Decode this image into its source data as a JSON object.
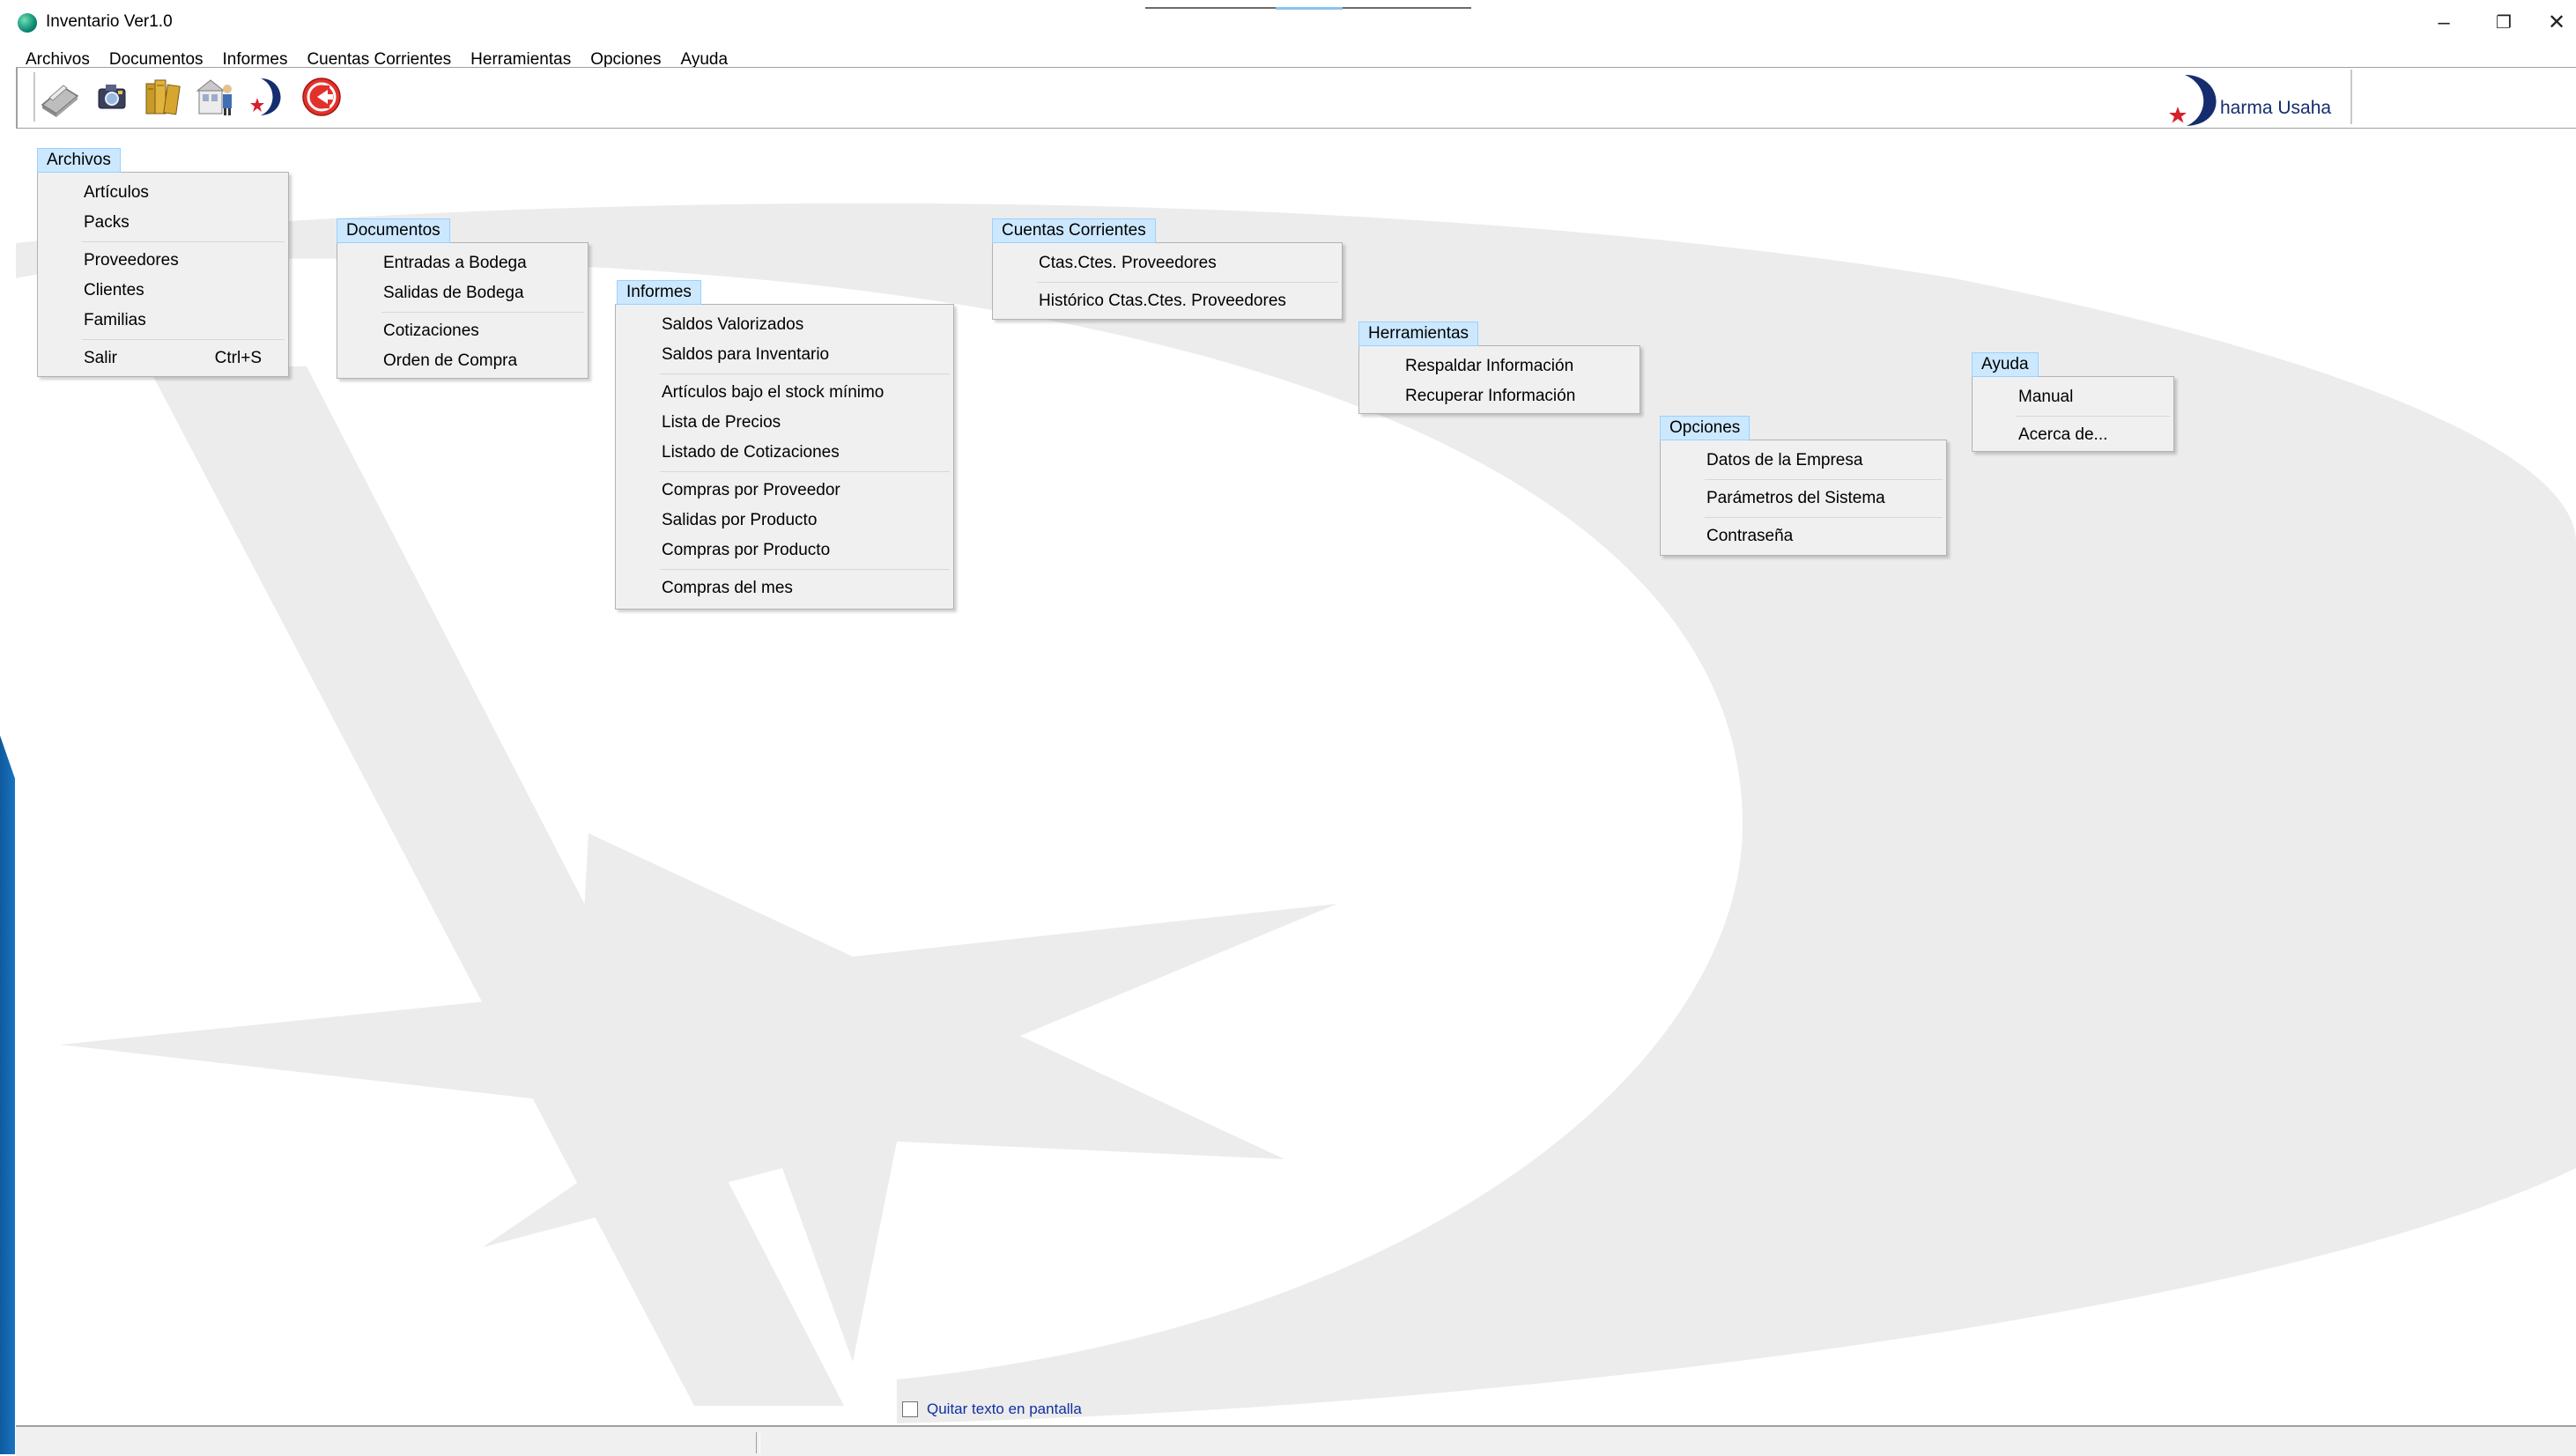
{
  "window": {
    "title": "Inventario Ver1.0",
    "minimize": "–",
    "restore": "❐",
    "close": "✕"
  },
  "menubar": [
    "Archivos",
    "Documentos",
    "Informes",
    "Cuentas Corrientes",
    "Herramientas",
    "Opciones",
    "Ayuda"
  ],
  "toolbar": {
    "buttons": [
      "scanner-icon",
      "camera-icon",
      "books-icon",
      "warehouse-icon",
      "dharma-logo-icon",
      "exit-icon"
    ],
    "brand_text": "harma Usaha"
  },
  "menus": {
    "archivos": {
      "title": "Archivos",
      "items": [
        {
          "label": "Artículos"
        },
        {
          "label": "Packs"
        },
        {
          "sep": true
        },
        {
          "label": "Proveedores"
        },
        {
          "label": "Clientes"
        },
        {
          "label": "Familias"
        },
        {
          "sep": true
        },
        {
          "label": "Salir",
          "shortcut": "Ctrl+S"
        }
      ]
    },
    "documentos": {
      "title": "Documentos",
      "items": [
        {
          "label": "Entradas a Bodega"
        },
        {
          "label": "Salidas de Bodega"
        },
        {
          "sep": true
        },
        {
          "label": "Cotizaciones"
        },
        {
          "label": "Orden de Compra"
        }
      ]
    },
    "informes": {
      "title": "Informes",
      "items": [
        {
          "label": "Saldos Valorizados"
        },
        {
          "label": "Saldos para Inventario"
        },
        {
          "sep": true
        },
        {
          "label": "Artículos bajo el stock mínimo"
        },
        {
          "label": "Lista de Precios"
        },
        {
          "label": "Listado de Cotizaciones"
        },
        {
          "sep": true
        },
        {
          "label": "Compras por Proveedor"
        },
        {
          "label": "Salidas por Producto"
        },
        {
          "label": "Compras por Producto"
        },
        {
          "sep": true
        },
        {
          "label": "Compras del mes"
        }
      ]
    },
    "cuentas": {
      "title": "Cuentas Corrientes",
      "items": [
        {
          "label": "Ctas.Ctes. Proveedores"
        },
        {
          "sep": true
        },
        {
          "label": "Histórico Ctas.Ctes. Proveedores"
        }
      ]
    },
    "herramientas": {
      "title": "Herramientas",
      "items": [
        {
          "label": "Respaldar Información"
        },
        {
          "label": "Recuperar Información"
        }
      ]
    },
    "opciones": {
      "title": "Opciones",
      "items": [
        {
          "label": "Datos de la Empresa"
        },
        {
          "sep": true
        },
        {
          "label": "Parámetros del Sistema"
        },
        {
          "sep": true
        },
        {
          "label": "Contraseña"
        }
      ]
    },
    "ayuda": {
      "title": "Ayuda",
      "items": [
        {
          "label": "Manual"
        },
        {
          "sep": true
        },
        {
          "label": "Acerca de..."
        }
      ]
    }
  },
  "remove_text_label": "Quitar texto en pantalla",
  "colors": {
    "menu_highlight": "#cce8ff",
    "menu_bg": "#f0f0f0",
    "watermark": "#ececec",
    "brand_blue": "#152d6e",
    "brand_red": "#d6202a"
  }
}
